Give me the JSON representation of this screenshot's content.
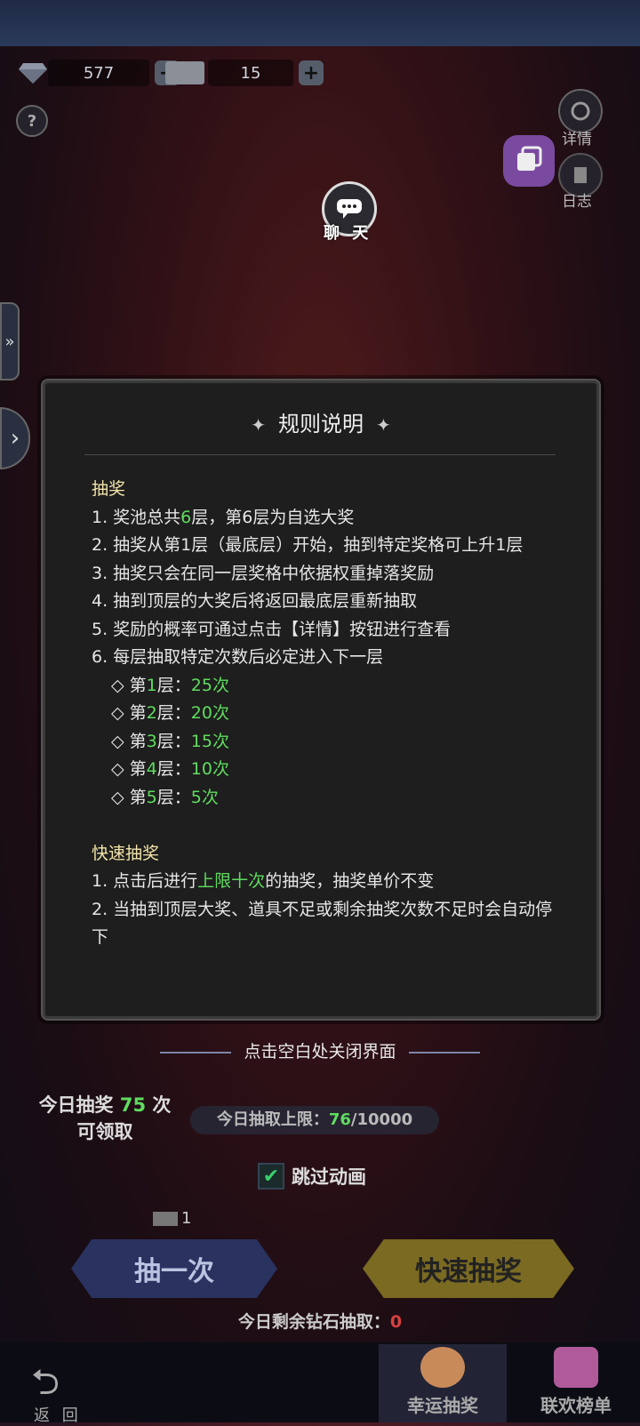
{
  "resources": {
    "diamond": {
      "value": "577",
      "icon": "diamond-icon"
    },
    "ticket": {
      "value": "15",
      "icon": "ticket-icon"
    },
    "add_symbol": "+"
  },
  "side": {
    "detail": "详情",
    "log": "日志"
  },
  "chat": {
    "label": "聊 天"
  },
  "panel": {
    "title": "规则说明",
    "sections": [
      {
        "heading": "抽奖"
      },
      {
        "heading": "快速抽奖"
      }
    ],
    "lottery": {
      "l1_a": "1. 奖池总共",
      "l1_num": "6",
      "l1_b": "层，第6层为自选大奖",
      "l2": "2. 抽奖从第1层（最底层）开始，抽到特定奖格可上升1层",
      "l3": "3. 抽奖只会在同一层奖格中依据权重掉落奖励",
      "l4": "4. 抽到顶层的大奖后将返回最底层重新抽取",
      "l5": "5. 奖励的概率可通过点击【详情】按钮进行查看",
      "l6": "6. 每层抽取特定次数后必定进入下一层",
      "tiers": [
        {
          "a": "◇ 第",
          "n": "1",
          "b": "层：",
          "c": "25次"
        },
        {
          "a": "◇ 第",
          "n": "2",
          "b": "层：",
          "c": "20次"
        },
        {
          "a": "◇ 第",
          "n": "3",
          "b": "层：",
          "c": "15次"
        },
        {
          "a": "◇ 第",
          "n": "4",
          "b": "层：",
          "c": "10次"
        },
        {
          "a": "◇ 第",
          "n": "5",
          "b": "层：",
          "c": "5次"
        }
      ]
    },
    "fast": {
      "f1_a": "1. 点击后进行",
      "f1_hl": "上限十次",
      "f1_b": "的抽奖，抽奖单价不变",
      "f2": "2. 当抽到顶层大奖、道具不足或剩余抽奖次数不足时会自动停下"
    }
  },
  "close_hint": "点击空白处关闭界面",
  "today": {
    "a": "今日抽奖 ",
    "num": "75",
    "b": " 次",
    "c": "可领取"
  },
  "limit": {
    "label": "今日抽取上限：",
    "used": "76",
    "total": "/10000"
  },
  "skip": {
    "label": "跳过动画",
    "checked": true
  },
  "ticket_cost": "1",
  "buttons": {
    "once": "抽一次",
    "fast": "快速抽奖"
  },
  "remain": {
    "label": "今日剩余钻石抽取：",
    "value": "0"
  },
  "nav": {
    "back": "返 回",
    "tabs": [
      "幸运抽奖",
      "联欢榜单"
    ],
    "active": 0
  }
}
